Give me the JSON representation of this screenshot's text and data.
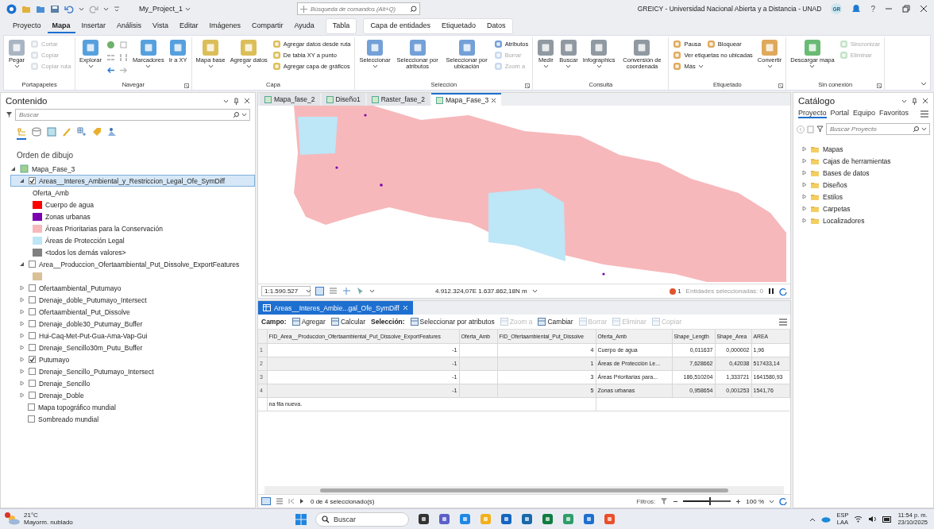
{
  "titlebar": {
    "project": "My_Project_1",
    "search": {
      "placeholder": "Búsqueda de comandos (Alt+Q)"
    },
    "user": "GREICY - Universidad Nacional Abierta y a Distancia - UNAD",
    "avatar": "GR",
    "help": "?"
  },
  "tabs": [
    {
      "label": "Proyecto",
      "kind": "main",
      "selected": false
    },
    {
      "label": "Mapa",
      "kind": "main",
      "selected": true
    },
    {
      "label": "Insertar",
      "kind": "main",
      "selected": false
    },
    {
      "label": "Análisis",
      "kind": "main",
      "selected": false
    },
    {
      "label": "Vista",
      "kind": "main",
      "selected": false
    },
    {
      "label": "Editar",
      "kind": "main",
      "selected": false
    },
    {
      "label": "Imágenes",
      "kind": "main",
      "selected": false
    },
    {
      "label": "Compartir",
      "kind": "main",
      "selected": false
    },
    {
      "label": "Ayuda",
      "kind": "main",
      "selected": false
    },
    {
      "label": "Tabla",
      "kind": "table",
      "selected": false
    },
    {
      "label": "Capa de entidades",
      "kind": "layer",
      "selected": false
    },
    {
      "label": "Etiquetado",
      "kind": "layer",
      "selected": false
    },
    {
      "label": "Datos",
      "kind": "layer",
      "selected": false
    }
  ],
  "ribbon": [
    {
      "label": "Portapapeles",
      "launcher": false,
      "items": [
        {
          "kind": "large",
          "label": "Pegar",
          "dropdown": true,
          "disabled": false
        },
        {
          "kind": "stack",
          "rows": [
            [
              {
                "label": "Cortar",
                "dropdown": false,
                "disabled": true
              }
            ],
            [
              {
                "label": "Copiar",
                "dropdown": false,
                "disabled": true
              }
            ],
            [
              {
                "label": "Copiar ruta",
                "dropdown": false,
                "disabled": true
              }
            ]
          ]
        }
      ]
    },
    {
      "label": "Navegar",
      "launcher": true,
      "items": [
        {
          "kind": "large",
          "label": "Explorar",
          "dropdown": true,
          "disabled": false
        },
        {
          "kind": "nav-tools"
        },
        {
          "kind": "large",
          "label": "Marcadores",
          "dropdown": true,
          "disabled": false
        },
        {
          "kind": "large",
          "label": "Ir a XY",
          "dropdown": false,
          "disabled": false
        }
      ]
    },
    {
      "label": "Capa",
      "launcher": false,
      "items": [
        {
          "kind": "large",
          "label": "Mapa base",
          "dropdown": true,
          "disabled": false
        },
        {
          "kind": "large",
          "label": "Agregar datos",
          "dropdown": true,
          "disabled": false
        },
        {
          "kind": "stack",
          "rows": [
            [
              {
                "label": "Agregar datos desde ruta",
                "dropdown": false,
                "disabled": false
              }
            ],
            [
              {
                "label": "De tabla XY a punto",
                "dropdown": false,
                "disabled": false
              }
            ],
            [
              {
                "label": "Agregar capa de gráficos",
                "dropdown": false,
                "disabled": false
              }
            ]
          ]
        }
      ]
    },
    {
      "label": "Selección",
      "launcher": true,
      "items": [
        {
          "kind": "large",
          "label": "Seleccionar",
          "dropdown": true,
          "disabled": false
        },
        {
          "kind": "large",
          "label": "Seleccionar por atributos",
          "dropdown": false,
          "disabled": false
        },
        {
          "kind": "large",
          "label": "Seleccionar por ubicación",
          "dropdown": false,
          "disabled": false
        },
        {
          "kind": "stack",
          "rows": [
            [
              {
                "label": "Atributos",
                "dropdown": false,
                "disabled": false
              }
            ],
            [
              {
                "label": "Borrar",
                "dropdown": false,
                "disabled": true
              }
            ],
            [
              {
                "label": "Zoom a",
                "dropdown": false,
                "disabled": true
              }
            ]
          ]
        }
      ]
    },
    {
      "label": "Consulta",
      "launcher": false,
      "items": [
        {
          "kind": "large",
          "label": "Medir",
          "dropdown": true,
          "disabled": false
        },
        {
          "kind": "large",
          "label": "Buscar",
          "dropdown": true,
          "disabled": false
        },
        {
          "kind": "large",
          "label": "Infographics",
          "dropdown": true,
          "disabled": false
        },
        {
          "kind": "large",
          "label": "Conversión de coordenada",
          "dropdown": false,
          "disabled": false
        }
      ]
    },
    {
      "label": "Etiquetado",
      "launcher": true,
      "items": [
        {
          "kind": "stack",
          "rows": [
            [
              {
                "label": "Pausa",
                "dropdown": false,
                "disabled": false
              },
              {
                "label": "Bloquear",
                "dropdown": false,
                "disabled": false
              }
            ],
            [
              {
                "label": "Ver etiquetas no ubicadas",
                "dropdown": false,
                "disabled": false
              }
            ],
            [
              {
                "label": "Más",
                "dropdown": true,
                "disabled": false
              }
            ]
          ]
        },
        {
          "kind": "large",
          "label": "Convertir",
          "dropdown": true,
          "disabled": false
        }
      ]
    },
    {
      "label": "Sin conexión",
      "launcher": true,
      "items": [
        {
          "kind": "large",
          "label": "Descargar mapa",
          "dropdown": true,
          "disabled": false
        },
        {
          "kind": "stack",
          "rows": [
            [
              {
                "label": "Sincronizar",
                "dropdown": false,
                "disabled": true
              }
            ],
            [
              {
                "label": "Eliminar",
                "dropdown": false,
                "disabled": true
              }
            ]
          ]
        }
      ]
    }
  ],
  "contents": {
    "title": "Contenido",
    "search": {
      "placeholder": "Buscar"
    },
    "view_buttons": [
      {
        "selected": true
      },
      {
        "selected": false
      },
      {
        "selected": false
      },
      {
        "selected": false
      },
      {
        "selected": false
      },
      {
        "selected": false
      },
      {
        "selected": false
      }
    ],
    "section": "Orden de dibujo",
    "map": {
      "label": "Mapa_Fase_3",
      "expanded": true,
      "children": [
        {
          "kind": "layer",
          "label": "Areas__Interes_Ambiental_y_Restriccion_Legal_Ofe_SymDiff",
          "checked": true,
          "selected": true,
          "expanded": true,
          "legend_heading": "Oferta_Amb",
          "legend": [
            {
              "label": "Cuerpo de agua",
              "color": "#ff0000"
            },
            {
              "label": "Zonas urbanas",
              "color": "#7a00b0"
            },
            {
              "label": "Áreas Prioritarias para la Conservación",
              "color": "#f7b8bb"
            },
            {
              "label": "Áreas de Protección Legal",
              "color": "#bde6f7"
            },
            {
              "label": "<todos los demás valores>",
              "color": "#808080"
            }
          ]
        },
        {
          "kind": "layer",
          "label": "Area__Produccion_Ofertaambiental_Put_Dissolve_ExportFeatures",
          "checked": false,
          "selected": false,
          "expanded": true,
          "legend": [
            {
              "color": "#d9c097"
            }
          ]
        },
        {
          "kind": "layer",
          "label": "Ofertaambiental_Putumayo",
          "checked": false,
          "selected": false,
          "expanded": false
        },
        {
          "kind": "layer",
          "label": "Drenaje_doble_Putumayo_Intersect",
          "checked": false,
          "selected": false,
          "expanded": false
        },
        {
          "kind": "layer",
          "label": "Ofertaambiental_Put_Dissolve",
          "checked": false,
          "selected": false,
          "expanded": false
        },
        {
          "kind": "layer",
          "label": "Drenaje_doble30_Putumay_Buffer",
          "checked": false,
          "selected": false,
          "expanded": false
        },
        {
          "kind": "layer",
          "label": "Hui-Caq-Met-Put-Gua-Ama-Vap-Gui",
          "checked": false,
          "selected": false,
          "expanded": false
        },
        {
          "kind": "layer",
          "label": "Drenaje_Sencillo30m_Putu_Buffer",
          "checked": false,
          "selected": false,
          "expanded": false
        },
        {
          "kind": "layer",
          "label": "Putumayo",
          "checked": true,
          "selected": false,
          "expanded": false
        },
        {
          "kind": "layer",
          "label": "Drenaje_Sencillo_Putumayo_Intersect",
          "checked": false,
          "selected": false,
          "expanded": false
        },
        {
          "kind": "layer",
          "label": "Drenaje_Sencillo",
          "checked": false,
          "selected": false,
          "expanded": false
        },
        {
          "kind": "layer",
          "label": "Drenaje_Doble",
          "checked": false,
          "selected": false,
          "expanded": false
        },
        {
          "kind": "basemap",
          "label": "Mapa topográfico mundial",
          "checked": false,
          "selected": false
        },
        {
          "kind": "basemap",
          "label": "Sombreado mundial",
          "checked": false,
          "selected": false
        }
      ]
    }
  },
  "map_tabs": [
    {
      "label": "Mapa_fase_2",
      "selected": false
    },
    {
      "label": "Diseño1",
      "selected": false
    },
    {
      "label": "Raster_fase_2",
      "selected": false
    },
    {
      "label": "Mapa_Fase_3",
      "selected": true
    }
  ],
  "map_status": {
    "scale": "1:1.590.527",
    "coordinates": "4.912.324,07E 1.637.862,18N m",
    "errors": "1",
    "selected_features": "Entidades seleccionadas: 0"
  },
  "table": {
    "tab": "Areas__Interes_Ambie...gal_Ofe_SymDiff",
    "toolbar": [
      {
        "kind": "label",
        "label": "Campo:",
        "disabled": false
      },
      {
        "kind": "button",
        "label": "Agregar",
        "disabled": false
      },
      {
        "kind": "button",
        "label": "Calcular",
        "disabled": false
      },
      {
        "kind": "label",
        "label": "Selección:",
        "disabled": false
      },
      {
        "kind": "button",
        "label": "Seleccionar por atributos",
        "disabled": false
      },
      {
        "kind": "button",
        "label": "Zoom a",
        "disabled": true
      },
      {
        "kind": "button",
        "label": "Cambiar",
        "disabled": false
      },
      {
        "kind": "button",
        "label": "Borrar",
        "disabled": true
      },
      {
        "kind": "button",
        "label": "Eliminar",
        "disabled": true
      },
      {
        "kind": "button",
        "label": "Copiar",
        "disabled": true
      }
    ],
    "columns": [
      {
        "label": "FID_Area__Produccion_Ofertaambiental_Put_Dissolve_ExportFeatures",
        "kind": "number"
      },
      {
        "label": "Oferta_Amb",
        "kind": "text"
      },
      {
        "label": "FID_Ofertaambiental_Put_Dissolve",
        "kind": "number"
      },
      {
        "label": "Oferta_Amb",
        "kind": "text"
      },
      {
        "label": "Shape_Length",
        "kind": "number"
      },
      {
        "label": "Shape_Area",
        "kind": "number"
      },
      {
        "label": "AREA",
        "kind": "text"
      }
    ],
    "rows": [
      {
        "number": "1",
        "cells": [
          "-1",
          null,
          "4",
          "Cuerpo de agua",
          "0,011637",
          "0,000002",
          "1,96"
        ]
      },
      {
        "number": "2",
        "cells": [
          "-1",
          null,
          "1",
          "Áreas de Protección Le...",
          "7,628662",
          "0,42038",
          "517433,14"
        ]
      },
      {
        "number": "3",
        "cells": [
          "-1",
          null,
          "3",
          "Áreas Prioritarias para...",
          "186,510204",
          "1,333721",
          "1641580,93"
        ]
      },
      {
        "number": "4",
        "cells": [
          "-1",
          null,
          "5",
          "Zonas urbanas",
          "0,958654",
          "0,001253",
          "1541,76"
        ]
      }
    ],
    "new_row": "na fila nueva.",
    "footer": {
      "selection": "0 de 4 seleccionado(s)",
      "filters": "Filtros:",
      "zoom": "100 %",
      "level": 0.55
    }
  },
  "catalog": {
    "title": "Catálogo",
    "tabs": [
      {
        "label": "Proyecto",
        "selected": true
      },
      {
        "label": "Portal",
        "selected": false
      },
      {
        "label": "Equipo",
        "selected": false
      },
      {
        "label": "Favoritos",
        "selected": false
      }
    ],
    "search": {
      "placeholder": "Buscar Proyecto"
    },
    "items": [
      {
        "label": "Mapas",
        "expanded": false
      },
      {
        "label": "Cajas de herramientas",
        "expanded": false
      },
      {
        "label": "Bases de datos",
        "expanded": false
      },
      {
        "label": "Diseños",
        "expanded": false
      },
      {
        "label": "Estilos",
        "expanded": false
      },
      {
        "label": "Carpetas",
        "expanded": false
      },
      {
        "label": "Localizadores",
        "expanded": false
      }
    ]
  },
  "taskbar": {
    "weather": {
      "temperature": "21°C",
      "condition": "Mayorm. nublado"
    },
    "search": {
      "placeholder": "Buscar"
    },
    "language": "ESP",
    "layout": "LAA",
    "time": "11:54 p. m.",
    "date": "23/10/2025"
  }
}
